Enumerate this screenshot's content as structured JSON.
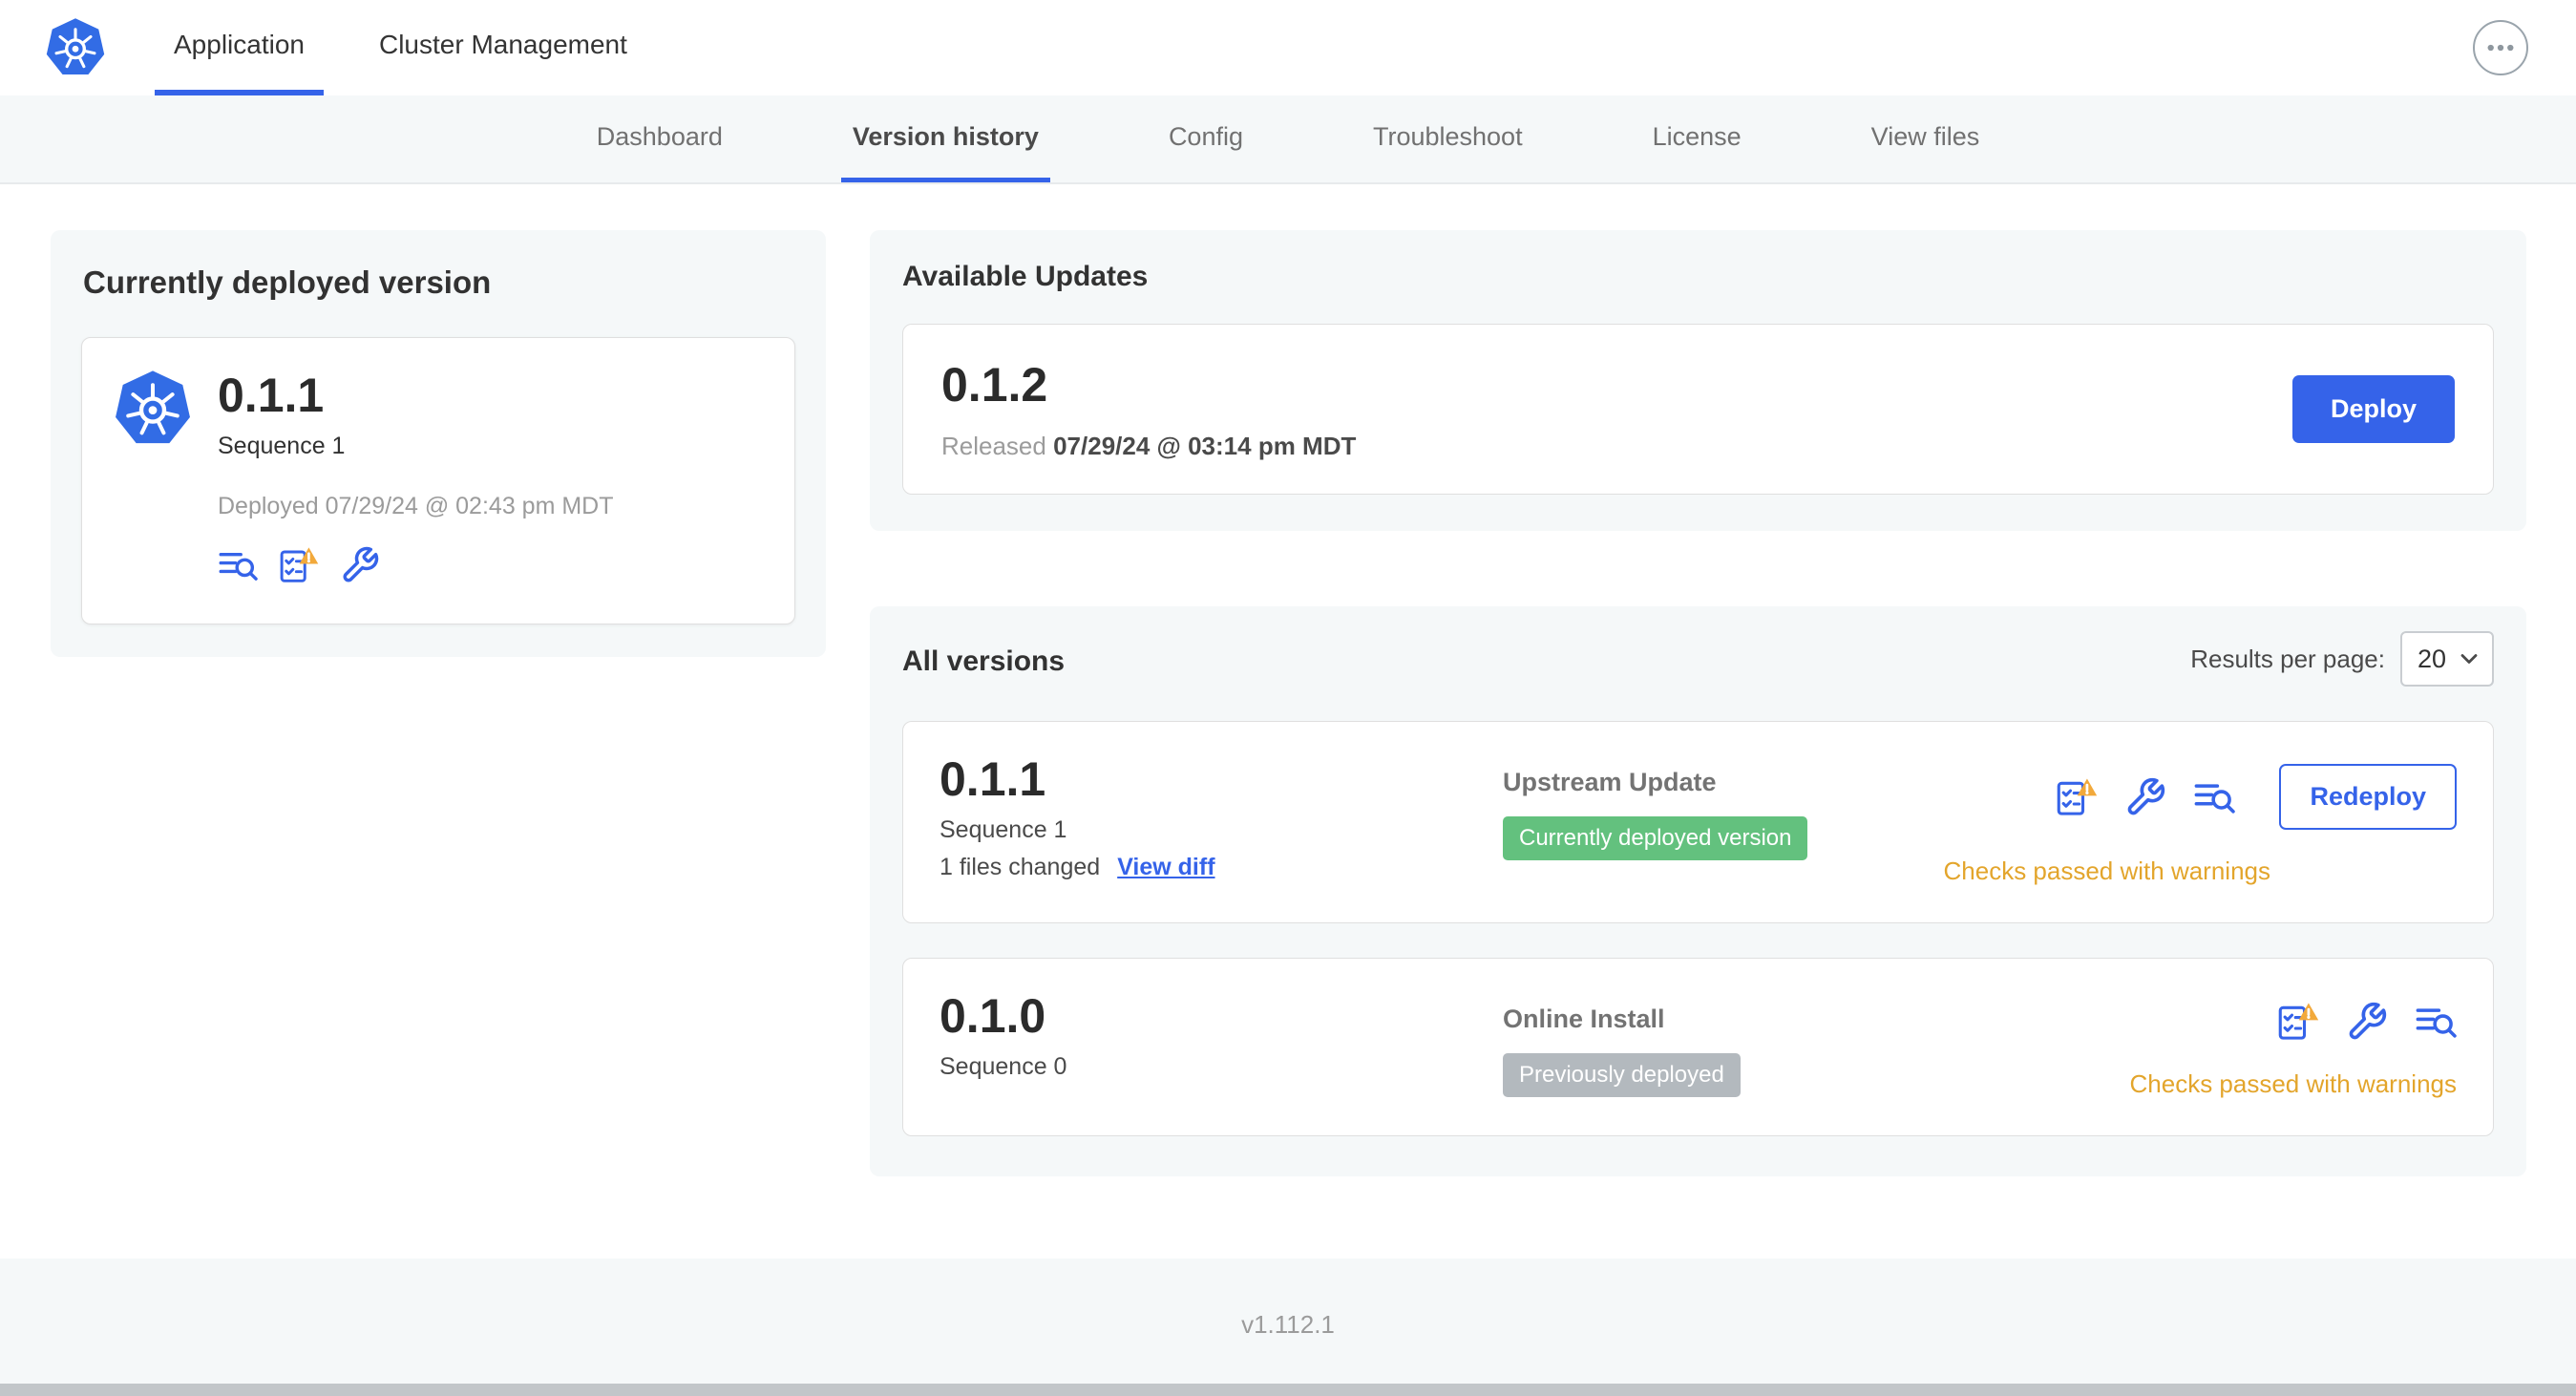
{
  "topnav": {
    "tabs": [
      {
        "label": "Application",
        "active": true
      },
      {
        "label": "Cluster Management",
        "active": false
      }
    ]
  },
  "subnav": {
    "tabs": [
      {
        "label": "Dashboard",
        "active": false
      },
      {
        "label": "Version history",
        "active": true
      },
      {
        "label": "Config",
        "active": false
      },
      {
        "label": "Troubleshoot",
        "active": false
      },
      {
        "label": "License",
        "active": false
      },
      {
        "label": "View files",
        "active": false
      }
    ]
  },
  "current_version": {
    "title": "Currently deployed version",
    "version": "0.1.1",
    "sequence": "Sequence 1",
    "deployed": "Deployed 07/29/24 @ 02:43 pm MDT",
    "icons": [
      "logs-icon",
      "preflight-checks-warning-icon",
      "config-tools-icon"
    ]
  },
  "available_updates": {
    "title": "Available Updates",
    "version": "0.1.2",
    "released_label": "Released",
    "released_date": "07/29/24 @ 03:14 pm MDT",
    "deploy_button": "Deploy"
  },
  "all_versions": {
    "title": "All versions",
    "results_per_page_label": "Results per page:",
    "results_per_page_value": "20",
    "rows": [
      {
        "version": "0.1.1",
        "sequence": "Sequence 1",
        "files_changed": "1 files changed",
        "view_diff_link": "View diff",
        "source": "Upstream Update",
        "badge": {
          "label": "Currently deployed version",
          "type": "green"
        },
        "checks_status": "Checks passed with warnings",
        "action_button": "Redeploy",
        "icons": [
          "preflight-checks-warning-icon",
          "config-tools-icon",
          "logs-icon"
        ]
      },
      {
        "version": "0.1.0",
        "sequence": "Sequence 0",
        "source": "Online Install",
        "badge": {
          "label": "Previously deployed",
          "type": "gray"
        },
        "checks_status": "Checks passed with warnings",
        "icons": [
          "preflight-checks-warning-icon",
          "config-tools-icon",
          "logs-icon"
        ]
      }
    ]
  },
  "footer": {
    "app_version": "v1.112.1"
  },
  "colors": {
    "primary_blue": "#3563E9",
    "kubernetes_blue": "#326CE5",
    "warning_text": "#E3A52C",
    "warning_triangle": "#F2A93B",
    "badge_green": "#63C17E",
    "badge_gray": "#B3B9BE",
    "section_bg": "#F5F8F9"
  }
}
